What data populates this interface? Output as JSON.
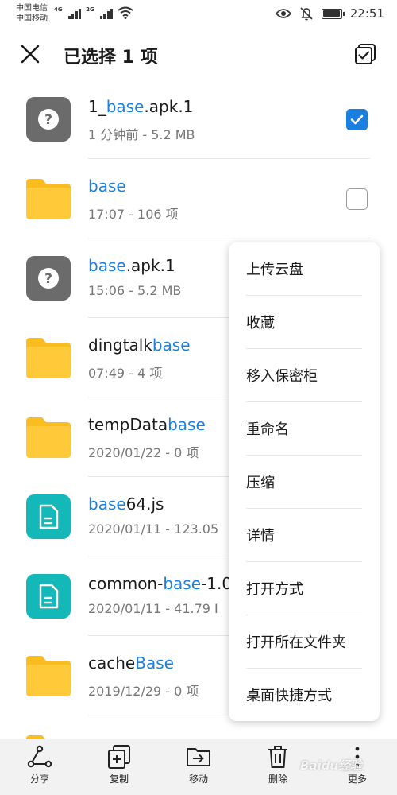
{
  "status_bar": {
    "carrier_1": "中国电信",
    "carrier_2": "中国移动",
    "net_1": "4G",
    "net_2": "2G",
    "time": "22:51",
    "icons": [
      "signal-icon",
      "wifi-icon",
      "eye-icon",
      "mute-icon",
      "battery-icon"
    ]
  },
  "header": {
    "title": "已选择 1 项"
  },
  "colors": {
    "accent": "#1a7fe0",
    "folder": "#fbbc1f",
    "doc": "#14b8b9",
    "unknown": "#6b6b6b"
  },
  "files": [
    {
      "type": "unknown",
      "name_pre": "1_",
      "name_hl": "base",
      "name_post": ".apk.1",
      "meta": "1 分钟前 - 5.2 MB",
      "checked": true
    },
    {
      "type": "folder",
      "name_pre": "",
      "name_hl": "base",
      "name_post": "",
      "meta": "17:07 - 106 项",
      "checked": false
    },
    {
      "type": "unknown",
      "name_pre": "",
      "name_hl": "base",
      "name_post": ".apk.1",
      "meta": "15:06 - 5.2 MB"
    },
    {
      "type": "folder",
      "name_pre": "dingtalk",
      "name_hl": "base",
      "name_post": "",
      "meta": "07:49 - 4 项"
    },
    {
      "type": "folder",
      "name_pre": "tempData",
      "name_hl": "base",
      "name_post": "",
      "meta": "2020/01/22 - 0 项"
    },
    {
      "type": "doc",
      "name_pre": "",
      "name_hl": "base",
      "name_post": "64.js",
      "meta": "2020/01/11 - 123.05"
    },
    {
      "type": "doc",
      "name_pre": "common-",
      "name_hl": "base",
      "name_post": "-1.0",
      "meta": "2020/01/11 - 41.79 I"
    },
    {
      "type": "folder",
      "name_pre": "cache",
      "name_hl": "Base",
      "name_post": "",
      "meta": "2019/12/29 - 0 项"
    },
    {
      "type": "folder",
      "name_pre": "",
      "name_hl": "",
      "name_post": "",
      "meta": ""
    }
  ],
  "menu": {
    "items": [
      "上传云盘",
      "收藏",
      "移入保密柜",
      "重命名",
      "压缩",
      "详情",
      "打开方式",
      "打开所在文件夹",
      "桌面快捷方式"
    ]
  },
  "toolbar": {
    "share": "分享",
    "copy": "复制",
    "move": "移动",
    "delete": "删除",
    "more": "更多"
  },
  "watermark": "Baidu经验"
}
